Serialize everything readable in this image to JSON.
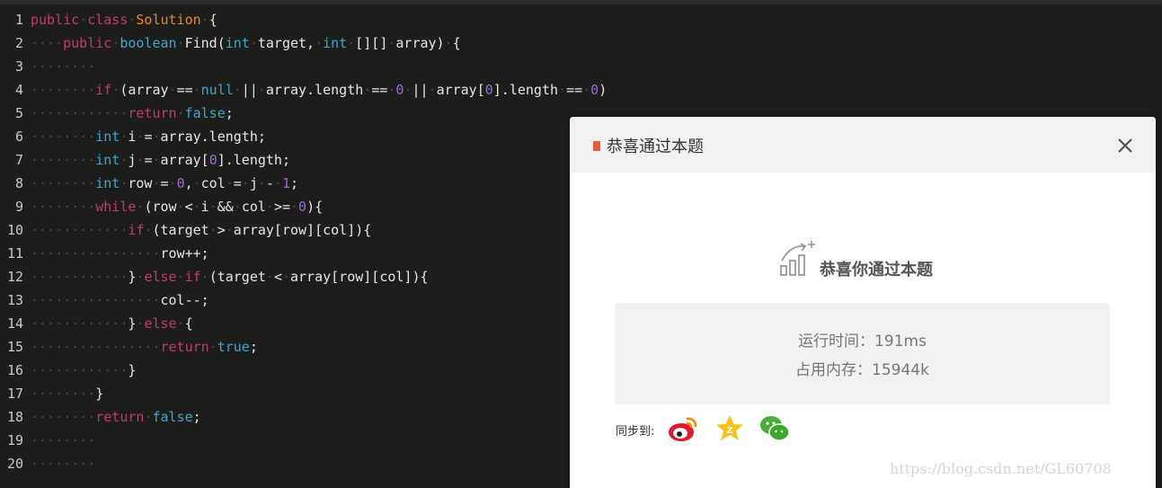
{
  "editor": {
    "lines": [
      {
        "n": "1",
        "tokens": [
          {
            "c": "kw",
            "t": "public"
          },
          {
            "c": "ws",
            "t": "·"
          },
          {
            "c": "kw",
            "t": "class"
          },
          {
            "c": "ws",
            "t": "·"
          },
          {
            "c": "cls",
            "t": "Solution"
          },
          {
            "c": "ws",
            "t": "·"
          },
          {
            "c": "pl",
            "t": "{"
          }
        ]
      },
      {
        "n": "2",
        "tokens": [
          {
            "c": "ws",
            "t": "····"
          },
          {
            "c": "kw",
            "t": "public"
          },
          {
            "c": "ws",
            "t": "·"
          },
          {
            "c": "ty",
            "t": "boolean"
          },
          {
            "c": "ws",
            "t": "·"
          },
          {
            "c": "pl",
            "t": "Find("
          },
          {
            "c": "ty",
            "t": "int"
          },
          {
            "c": "ws",
            "t": "·"
          },
          {
            "c": "pl",
            "t": "target,"
          },
          {
            "c": "ws",
            "t": "·"
          },
          {
            "c": "ty",
            "t": "int"
          },
          {
            "c": "ws",
            "t": "·"
          },
          {
            "c": "pl",
            "t": "[][]"
          },
          {
            "c": "ws",
            "t": "·"
          },
          {
            "c": "pl",
            "t": "array)"
          },
          {
            "c": "ws",
            "t": "·"
          },
          {
            "c": "pl",
            "t": "{"
          }
        ]
      },
      {
        "n": "3",
        "tokens": [
          {
            "c": "ws",
            "t": "········"
          }
        ]
      },
      {
        "n": "4",
        "tokens": [
          {
            "c": "ws",
            "t": "········"
          },
          {
            "c": "kw",
            "t": "if"
          },
          {
            "c": "ws",
            "t": "·"
          },
          {
            "c": "pl",
            "t": "(array"
          },
          {
            "c": "ws",
            "t": "·"
          },
          {
            "c": "pl",
            "t": "=="
          },
          {
            "c": "ws",
            "t": "·"
          },
          {
            "c": "ty",
            "t": "null"
          },
          {
            "c": "ws",
            "t": "·"
          },
          {
            "c": "pl",
            "t": "||"
          },
          {
            "c": "ws",
            "t": "·"
          },
          {
            "c": "pl",
            "t": "array.length"
          },
          {
            "c": "ws",
            "t": "·"
          },
          {
            "c": "pl",
            "t": "=="
          },
          {
            "c": "ws",
            "t": "·"
          },
          {
            "c": "num",
            "t": "0"
          },
          {
            "c": "ws",
            "t": "·"
          },
          {
            "c": "pl",
            "t": "||"
          },
          {
            "c": "ws",
            "t": "·"
          },
          {
            "c": "pl",
            "t": "array["
          },
          {
            "c": "num",
            "t": "0"
          },
          {
            "c": "pl",
            "t": "].length"
          },
          {
            "c": "ws",
            "t": "·"
          },
          {
            "c": "pl",
            "t": "=="
          },
          {
            "c": "ws",
            "t": "·"
          },
          {
            "c": "num",
            "t": "0"
          },
          {
            "c": "pl",
            "t": ")"
          }
        ]
      },
      {
        "n": "5",
        "tokens": [
          {
            "c": "ws",
            "t": "············"
          },
          {
            "c": "kw",
            "t": "return"
          },
          {
            "c": "ws",
            "t": "·"
          },
          {
            "c": "ty",
            "t": "false"
          },
          {
            "c": "pl",
            "t": ";"
          }
        ]
      },
      {
        "n": "6",
        "tokens": [
          {
            "c": "ws",
            "t": "········"
          },
          {
            "c": "ty",
            "t": "int"
          },
          {
            "c": "ws",
            "t": "·"
          },
          {
            "c": "pl",
            "t": "i"
          },
          {
            "c": "ws",
            "t": "·"
          },
          {
            "c": "pl",
            "t": "="
          },
          {
            "c": "ws",
            "t": "·"
          },
          {
            "c": "pl",
            "t": "array.length;"
          }
        ]
      },
      {
        "n": "7",
        "tokens": [
          {
            "c": "ws",
            "t": "········"
          },
          {
            "c": "ty",
            "t": "int"
          },
          {
            "c": "ws",
            "t": "·"
          },
          {
            "c": "pl",
            "t": "j"
          },
          {
            "c": "ws",
            "t": "·"
          },
          {
            "c": "pl",
            "t": "="
          },
          {
            "c": "ws",
            "t": "·"
          },
          {
            "c": "pl",
            "t": "array["
          },
          {
            "c": "num",
            "t": "0"
          },
          {
            "c": "pl",
            "t": "].length;"
          }
        ]
      },
      {
        "n": "8",
        "tokens": [
          {
            "c": "ws",
            "t": "········"
          },
          {
            "c": "ty",
            "t": "int"
          },
          {
            "c": "ws",
            "t": "·"
          },
          {
            "c": "pl",
            "t": "row"
          },
          {
            "c": "ws",
            "t": "·"
          },
          {
            "c": "pl",
            "t": "="
          },
          {
            "c": "ws",
            "t": "·"
          },
          {
            "c": "num",
            "t": "0"
          },
          {
            "c": "pl",
            "t": ","
          },
          {
            "c": "ws",
            "t": "·"
          },
          {
            "c": "pl",
            "t": "col"
          },
          {
            "c": "ws",
            "t": "·"
          },
          {
            "c": "pl",
            "t": "="
          },
          {
            "c": "ws",
            "t": "·"
          },
          {
            "c": "pl",
            "t": "j"
          },
          {
            "c": "ws",
            "t": "·"
          },
          {
            "c": "pl",
            "t": "-"
          },
          {
            "c": "ws",
            "t": "·"
          },
          {
            "c": "num",
            "t": "1"
          },
          {
            "c": "pl",
            "t": ";"
          }
        ]
      },
      {
        "n": "9",
        "tokens": [
          {
            "c": "ws",
            "t": "········"
          },
          {
            "c": "kw",
            "t": "while"
          },
          {
            "c": "ws",
            "t": "·"
          },
          {
            "c": "pl",
            "t": "(row"
          },
          {
            "c": "ws",
            "t": "·"
          },
          {
            "c": "pl",
            "t": "<"
          },
          {
            "c": "ws",
            "t": "·"
          },
          {
            "c": "pl",
            "t": "i"
          },
          {
            "c": "ws",
            "t": "·"
          },
          {
            "c": "pl",
            "t": "&&"
          },
          {
            "c": "ws",
            "t": "·"
          },
          {
            "c": "pl",
            "t": "col"
          },
          {
            "c": "ws",
            "t": "·"
          },
          {
            "c": "pl",
            "t": ">="
          },
          {
            "c": "ws",
            "t": "·"
          },
          {
            "c": "num",
            "t": "0"
          },
          {
            "c": "pl",
            "t": "){"
          }
        ]
      },
      {
        "n": "10",
        "tokens": [
          {
            "c": "ws",
            "t": "············"
          },
          {
            "c": "kw",
            "t": "if"
          },
          {
            "c": "ws",
            "t": "·"
          },
          {
            "c": "pl",
            "t": "(target"
          },
          {
            "c": "ws",
            "t": "·"
          },
          {
            "c": "pl",
            "t": ">"
          },
          {
            "c": "ws",
            "t": "·"
          },
          {
            "c": "pl",
            "t": "array[row][col]){"
          }
        ]
      },
      {
        "n": "11",
        "tokens": [
          {
            "c": "ws",
            "t": "················"
          },
          {
            "c": "pl",
            "t": "row++;"
          }
        ]
      },
      {
        "n": "12",
        "tokens": [
          {
            "c": "ws",
            "t": "············"
          },
          {
            "c": "pl",
            "t": "}"
          },
          {
            "c": "ws",
            "t": "·"
          },
          {
            "c": "kw",
            "t": "else"
          },
          {
            "c": "ws",
            "t": "·"
          },
          {
            "c": "kw",
            "t": "if"
          },
          {
            "c": "ws",
            "t": "·"
          },
          {
            "c": "pl",
            "t": "(target"
          },
          {
            "c": "ws",
            "t": "·"
          },
          {
            "c": "pl",
            "t": "<"
          },
          {
            "c": "ws",
            "t": "·"
          },
          {
            "c": "pl",
            "t": "array[row][col]){"
          }
        ]
      },
      {
        "n": "13",
        "tokens": [
          {
            "c": "ws",
            "t": "················"
          },
          {
            "c": "pl",
            "t": "col--;"
          }
        ]
      },
      {
        "n": "14",
        "tokens": [
          {
            "c": "ws",
            "t": "············"
          },
          {
            "c": "pl",
            "t": "}"
          },
          {
            "c": "ws",
            "t": "·"
          },
          {
            "c": "kw",
            "t": "else"
          },
          {
            "c": "ws",
            "t": "·"
          },
          {
            "c": "pl",
            "t": "{"
          }
        ]
      },
      {
        "n": "15",
        "tokens": [
          {
            "c": "ws",
            "t": "················"
          },
          {
            "c": "kw",
            "t": "return"
          },
          {
            "c": "ws",
            "t": "·"
          },
          {
            "c": "ty",
            "t": "true"
          },
          {
            "c": "pl",
            "t": ";"
          }
        ]
      },
      {
        "n": "16",
        "tokens": [
          {
            "c": "ws",
            "t": "············"
          },
          {
            "c": "pl",
            "t": "}"
          }
        ]
      },
      {
        "n": "17",
        "tokens": [
          {
            "c": "ws",
            "t": "········"
          },
          {
            "c": "pl",
            "t": "}"
          }
        ]
      },
      {
        "n": "18",
        "tokens": [
          {
            "c": "ws",
            "t": "········"
          },
          {
            "c": "kw",
            "t": "return"
          },
          {
            "c": "ws",
            "t": "·"
          },
          {
            "c": "ty",
            "t": "false"
          },
          {
            "c": "pl",
            "t": ";"
          }
        ]
      },
      {
        "n": "19",
        "tokens": [
          {
            "c": "ws",
            "t": "········"
          }
        ]
      },
      {
        "n": "20",
        "tokens": [
          {
            "c": "ws",
            "t": "········"
          }
        ]
      }
    ]
  },
  "dialog": {
    "title": "恭喜通过本题",
    "success_text": "恭喜你通过本题",
    "runtime": "运行时间：191ms",
    "memory": "占用内存：15944k",
    "share_label": "同步到:",
    "share_icons": [
      "weibo-icon",
      "qzone-icon",
      "wechat-icon"
    ],
    "accent": "#f05a3a"
  },
  "watermark": "https://blog.csdn.net/GL60708"
}
